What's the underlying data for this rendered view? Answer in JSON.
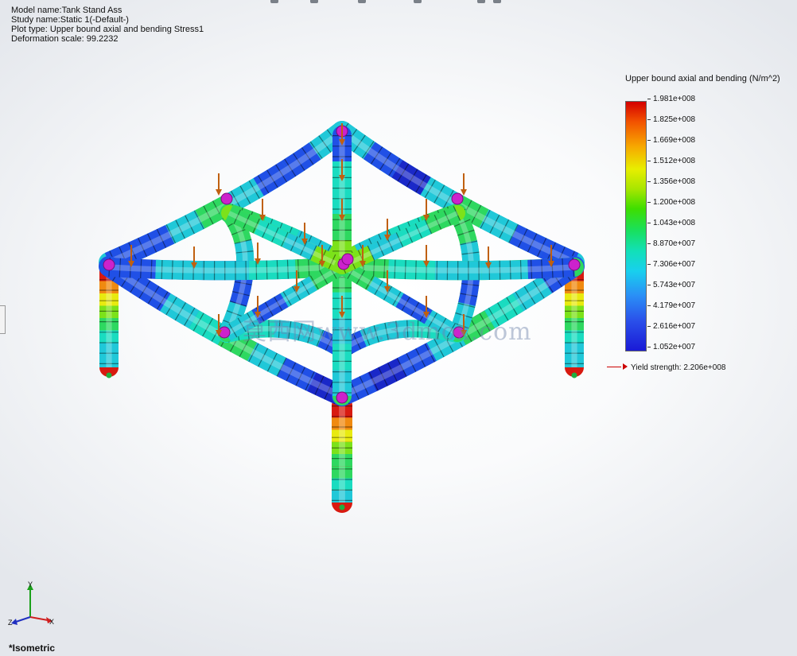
{
  "info": {
    "model_name": "Model name:Tank Stand Ass",
    "study_name": "Study name:Static 1(-Default-)",
    "plot_type": "Plot type: Upper bound axial and bending Stress1",
    "deformation_scale": "Deformation scale: 99.2232"
  },
  "legend": {
    "title": "Upper bound axial and bending (N/m^2)",
    "ticks": [
      "1.981e+008",
      "1.825e+008",
      "1.669e+008",
      "1.512e+008",
      "1.356e+008",
      "1.200e+008",
      "1.043e+008",
      "8.870e+007",
      "7.306e+007",
      "5.743e+007",
      "4.179e+007",
      "2.616e+007",
      "1.052e+007"
    ],
    "yield": "Yield strength: 2.206e+008",
    "yield_color": "#cc0000"
  },
  "view": {
    "name": "*Isometric"
  },
  "triad": {
    "x": "X",
    "y": "Y",
    "z": "Z"
  },
  "watermark": "莫西网www.3dmox.com",
  "colors": {
    "load_arrow": "#c06010",
    "joint": "#cc22cc"
  }
}
